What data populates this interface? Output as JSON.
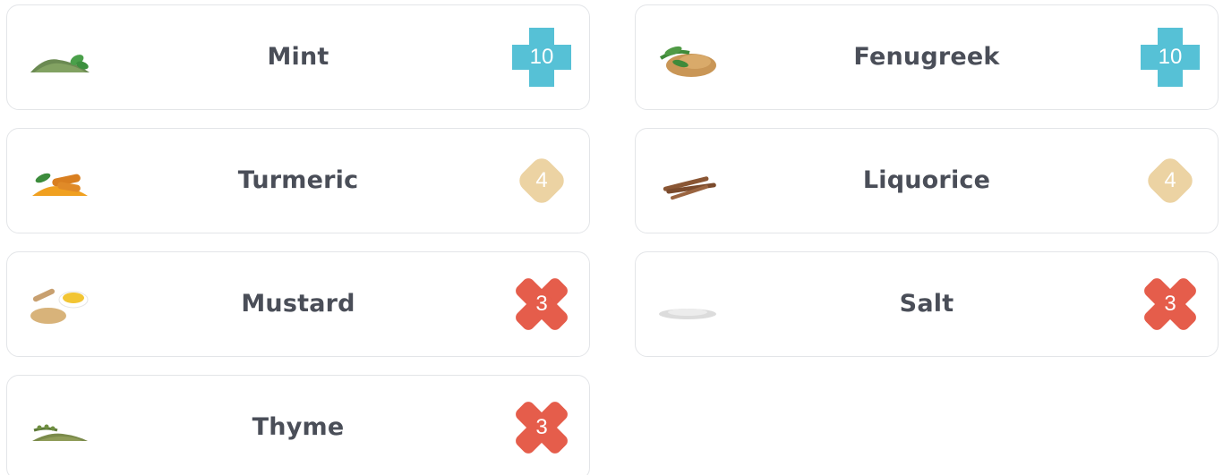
{
  "spices": [
    {
      "name": "Mint",
      "score": "10",
      "badge_shape": "plus-icon",
      "badge_color": "#56c1d6"
    },
    {
      "name": "Fenugreek",
      "score": "10",
      "badge_shape": "plus-icon",
      "badge_color": "#56c1d6"
    },
    {
      "name": "Turmeric",
      "score": "4",
      "badge_shape": "diamond-icon",
      "badge_color": "#ecd3a3"
    },
    {
      "name": "Liquorice",
      "score": "4",
      "badge_shape": "diamond-icon",
      "badge_color": "#ecd3a3"
    },
    {
      "name": "Mustard",
      "score": "3",
      "badge_shape": "cross-icon",
      "badge_color": "#e55d4b"
    },
    {
      "name": "Salt",
      "score": "3",
      "badge_shape": "cross-icon",
      "badge_color": "#e55d4b"
    },
    {
      "name": "Thyme",
      "score": "3",
      "badge_shape": "cross-icon",
      "badge_color": "#e55d4b"
    }
  ]
}
